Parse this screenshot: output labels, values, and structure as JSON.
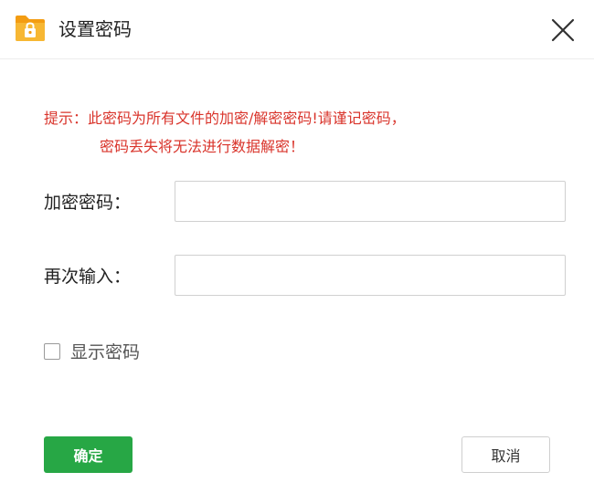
{
  "window": {
    "title": "设置密码",
    "app_icon": "folder-lock-icon",
    "close_icon": "close-icon"
  },
  "notice": {
    "line1": "提示：此密码为所有文件的加密/解密密码!请谨记密码，",
    "line2": "密码丢失将无法进行数据解密！"
  },
  "form": {
    "password_label": "加密密码：",
    "password_value": "",
    "confirm_label": "再次输入：",
    "confirm_value": "",
    "show_password_label": "显示密码",
    "show_password_checked": false
  },
  "buttons": {
    "ok_label": "确定",
    "cancel_label": "取消"
  },
  "colors": {
    "notice": "#d9342b",
    "ok_button": "#27a745",
    "folder": "#f5a623"
  }
}
